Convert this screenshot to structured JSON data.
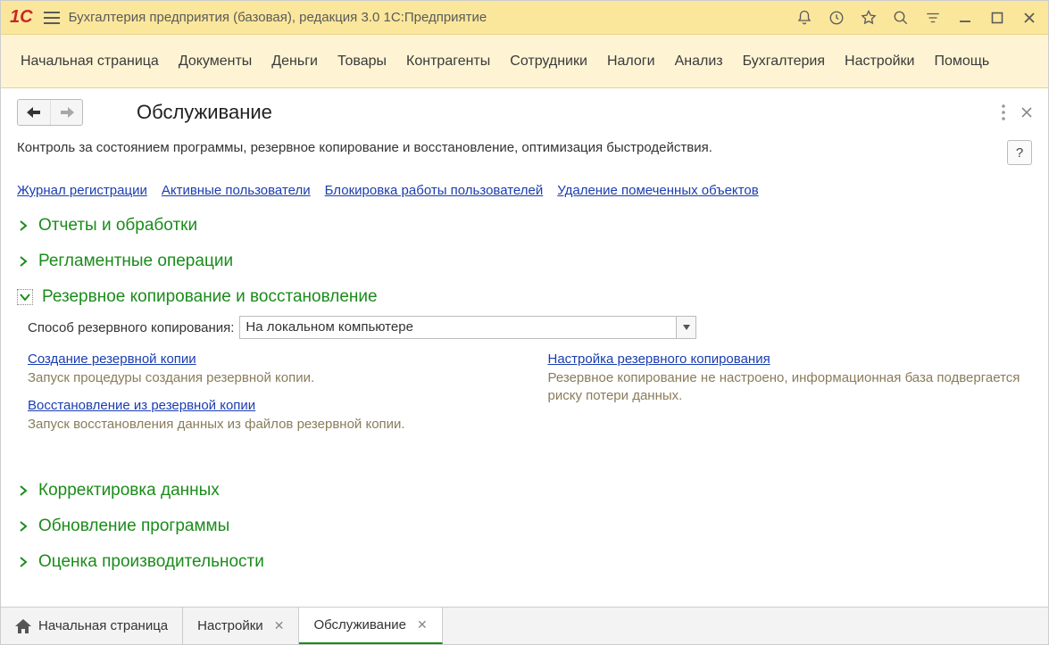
{
  "title": "Бухгалтерия предприятия (базовая), редакция 3.0 1С:Предприятие",
  "mainmenu": [
    "Начальная страница",
    "Документы",
    "Деньги",
    "Товары",
    "Контрагенты",
    "Сотрудники",
    "Налоги",
    "Анализ",
    "Бухгалтерия",
    "Настройки",
    "Помощь"
  ],
  "page": {
    "title": "Обслуживание",
    "description": "Контроль за состоянием программы, резервное копирование и восстановление, оптимизация быстродействия.",
    "help_label": "?"
  },
  "toplinks": [
    "Журнал регистрации",
    "Активные пользователи",
    "Блокировка работы пользователей",
    "Удаление помеченных объектов"
  ],
  "sections": {
    "reports": "Отчеты и обработки",
    "reglament": "Регламентные операции",
    "backup": {
      "title": "Резервное копирование и восстановление",
      "method_label": "Способ резервного копирования:",
      "method_value": "На локальном компьютере",
      "left": {
        "create_link": "Создание резервной копии",
        "create_desc": "Запуск процедуры создания резервной копии.",
        "restore_link": "Восстановление из резервной копии",
        "restore_desc": "Запуск восстановления данных из файлов резервной копии."
      },
      "right": {
        "settings_link": "Настройка резервного копирования",
        "settings_desc": "Резервное копирование не настроено, информационная база подвергается риску потери данных."
      }
    },
    "correction": "Корректировка данных",
    "update": "Обновление программы",
    "perf": "Оценка производительности"
  },
  "bottom_tabs": {
    "home": "Начальная страница",
    "settings": "Настройки",
    "service": "Обслуживание"
  }
}
